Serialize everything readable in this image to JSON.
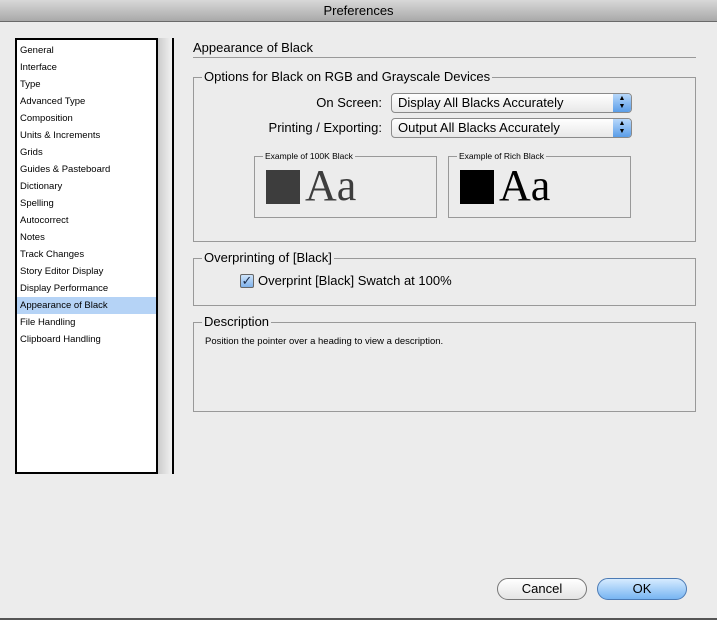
{
  "window": {
    "title": "Preferences"
  },
  "sidebar": {
    "items": [
      {
        "label": "General"
      },
      {
        "label": "Interface"
      },
      {
        "label": "Type"
      },
      {
        "label": "Advanced Type"
      },
      {
        "label": "Composition"
      },
      {
        "label": "Units & Increments"
      },
      {
        "label": "Grids"
      },
      {
        "label": "Guides & Pasteboard"
      },
      {
        "label": "Dictionary"
      },
      {
        "label": "Spelling"
      },
      {
        "label": "Autocorrect"
      },
      {
        "label": "Notes"
      },
      {
        "label": "Track Changes"
      },
      {
        "label": "Story Editor Display"
      },
      {
        "label": "Display Performance"
      },
      {
        "label": "Appearance of Black",
        "selected": true
      },
      {
        "label": "File Handling"
      },
      {
        "label": "Clipboard Handling"
      }
    ]
  },
  "panel": {
    "title": "Appearance of Black",
    "options": {
      "title": "Options for Black on RGB and Grayscale Devices",
      "on_screen_label": "On Screen:",
      "on_screen_value": "Display All Blacks Accurately",
      "printing_label": "Printing / Exporting:",
      "printing_value": "Output All Blacks Accurately",
      "example_100k": {
        "label": "Example of 100K Black",
        "text": "Aa",
        "color": "#3d3d3d"
      },
      "example_rich": {
        "label": "Example of Rich Black",
        "text": "Aa",
        "color": "#000000"
      }
    },
    "overprinting": {
      "title": "Overprinting of [Black]",
      "checkbox_label": "Overprint [Black] Swatch at 100%",
      "checked": true
    },
    "description": {
      "title": "Description",
      "text": "Position the pointer over a heading to view a description."
    }
  },
  "buttons": {
    "cancel": "Cancel",
    "ok": "OK"
  },
  "colors": {
    "selection": "#b5d3f6",
    "default_button": "#78b5f2"
  }
}
